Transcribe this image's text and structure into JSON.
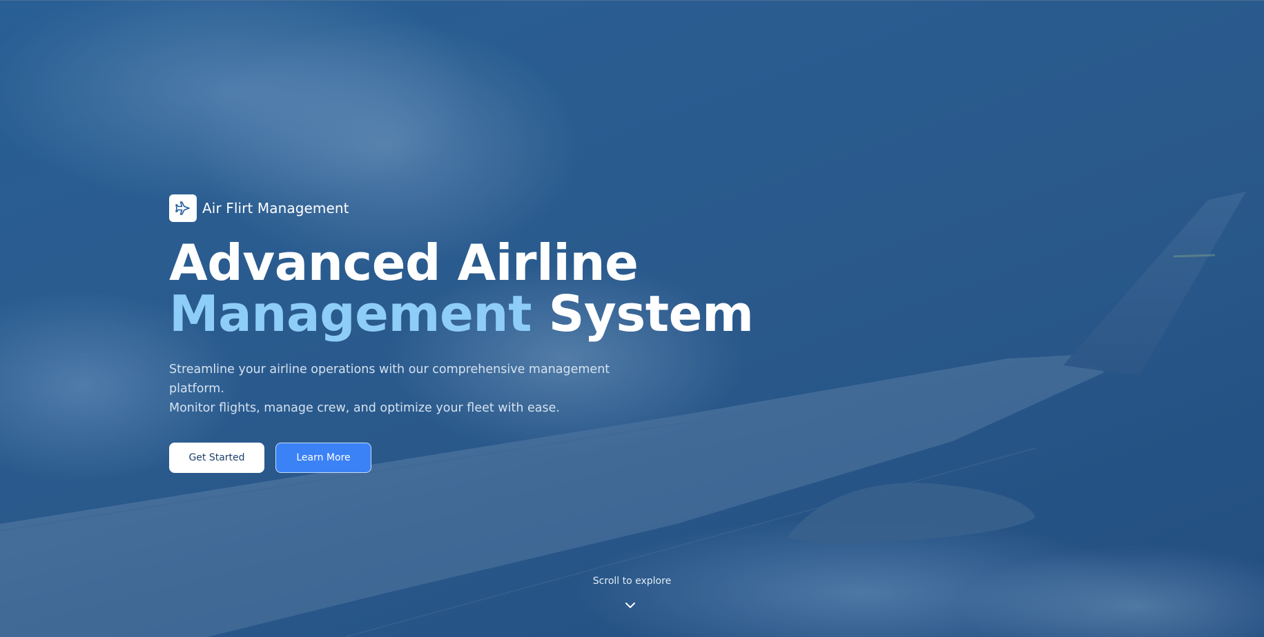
{
  "brand": {
    "logo_icon": "airplane-icon",
    "name": "Air Flirt Management"
  },
  "hero": {
    "headline_line1": "Advanced Airline",
    "headline_accent": "Management",
    "headline_line2_rest": "System",
    "tagline_line1": "Streamline your airline operations with our comprehensive management platform.",
    "tagline_line2": "Monitor flights, manage crew, and optimize your fleet with ease."
  },
  "actions": {
    "primary_label": "Get Started",
    "secondary_label": "Learn More"
  },
  "scroll": {
    "label": "Scroll to explore",
    "icon": "chevron-down-icon"
  },
  "colors": {
    "overlay": "#2b5e92",
    "accent_text": "#8ecdf8",
    "primary_button_bg": "#ffffff",
    "secondary_button_bg": "#3b82f6"
  }
}
